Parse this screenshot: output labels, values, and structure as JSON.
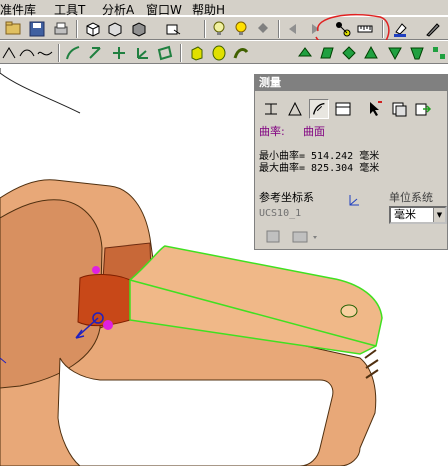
{
  "menubar": {
    "items": [
      "准件库",
      "工具T",
      "分析A",
      "窗口W",
      "帮助H"
    ]
  },
  "panel": {
    "title": "测量",
    "curvature_label": "曲率:",
    "curvature_type": "曲面",
    "min_curvature": "最小曲率=  514.242 毫米",
    "max_curvature": "最大曲率= 825.304 毫米",
    "ref_coord_label": "参考坐标系",
    "ref_coord_value": "UCS10_1",
    "unit_system_label": "单位系统",
    "unit_value": "毫米"
  },
  "colors": {
    "ui_face": "#d4d0c8",
    "panel_title_bg": "#808080",
    "measure_text": "#800080",
    "model_body": "#e8a878",
    "highlight_edge": "#40e020",
    "annotation_circle": "#e02020",
    "selected_patch": "#c84818"
  },
  "icons": [
    "save-icon",
    "print-icon",
    "box-icon",
    "lightbulb-icon",
    "arrow-left-icon",
    "arrow-right-icon",
    "measure-icon",
    "ruler-icon",
    "paint-icon",
    "pen-icon",
    "curvature-icon",
    "area-icon",
    "table-icon",
    "cursor-icon"
  ]
}
